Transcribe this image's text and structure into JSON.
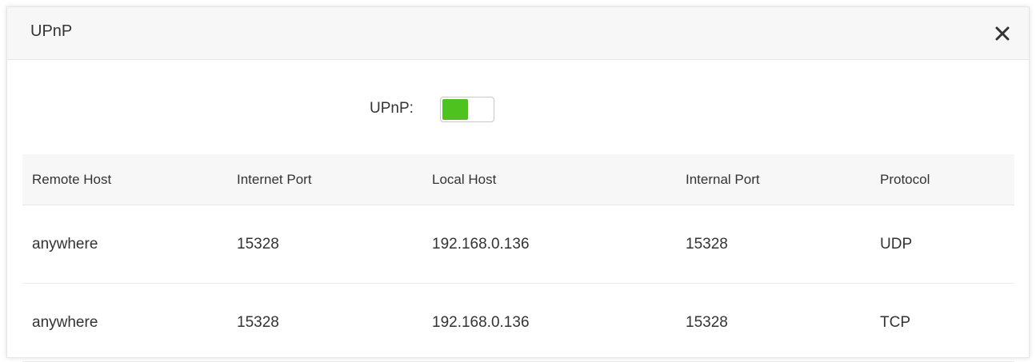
{
  "dialog": {
    "title": "UPnP",
    "close_icon": "close-icon"
  },
  "upnp": {
    "label": "UPnP:",
    "enabled": true,
    "accent": "#4ec21f"
  },
  "table": {
    "headers": [
      "Remote Host",
      "Internet Port",
      "Local Host",
      "Internal Port",
      "Protocol"
    ],
    "rows": [
      [
        "anywhere",
        "15328",
        "192.168.0.136",
        "15328",
        "UDP"
      ],
      [
        "anywhere",
        "15328",
        "192.168.0.136",
        "15328",
        "TCP"
      ]
    ]
  }
}
